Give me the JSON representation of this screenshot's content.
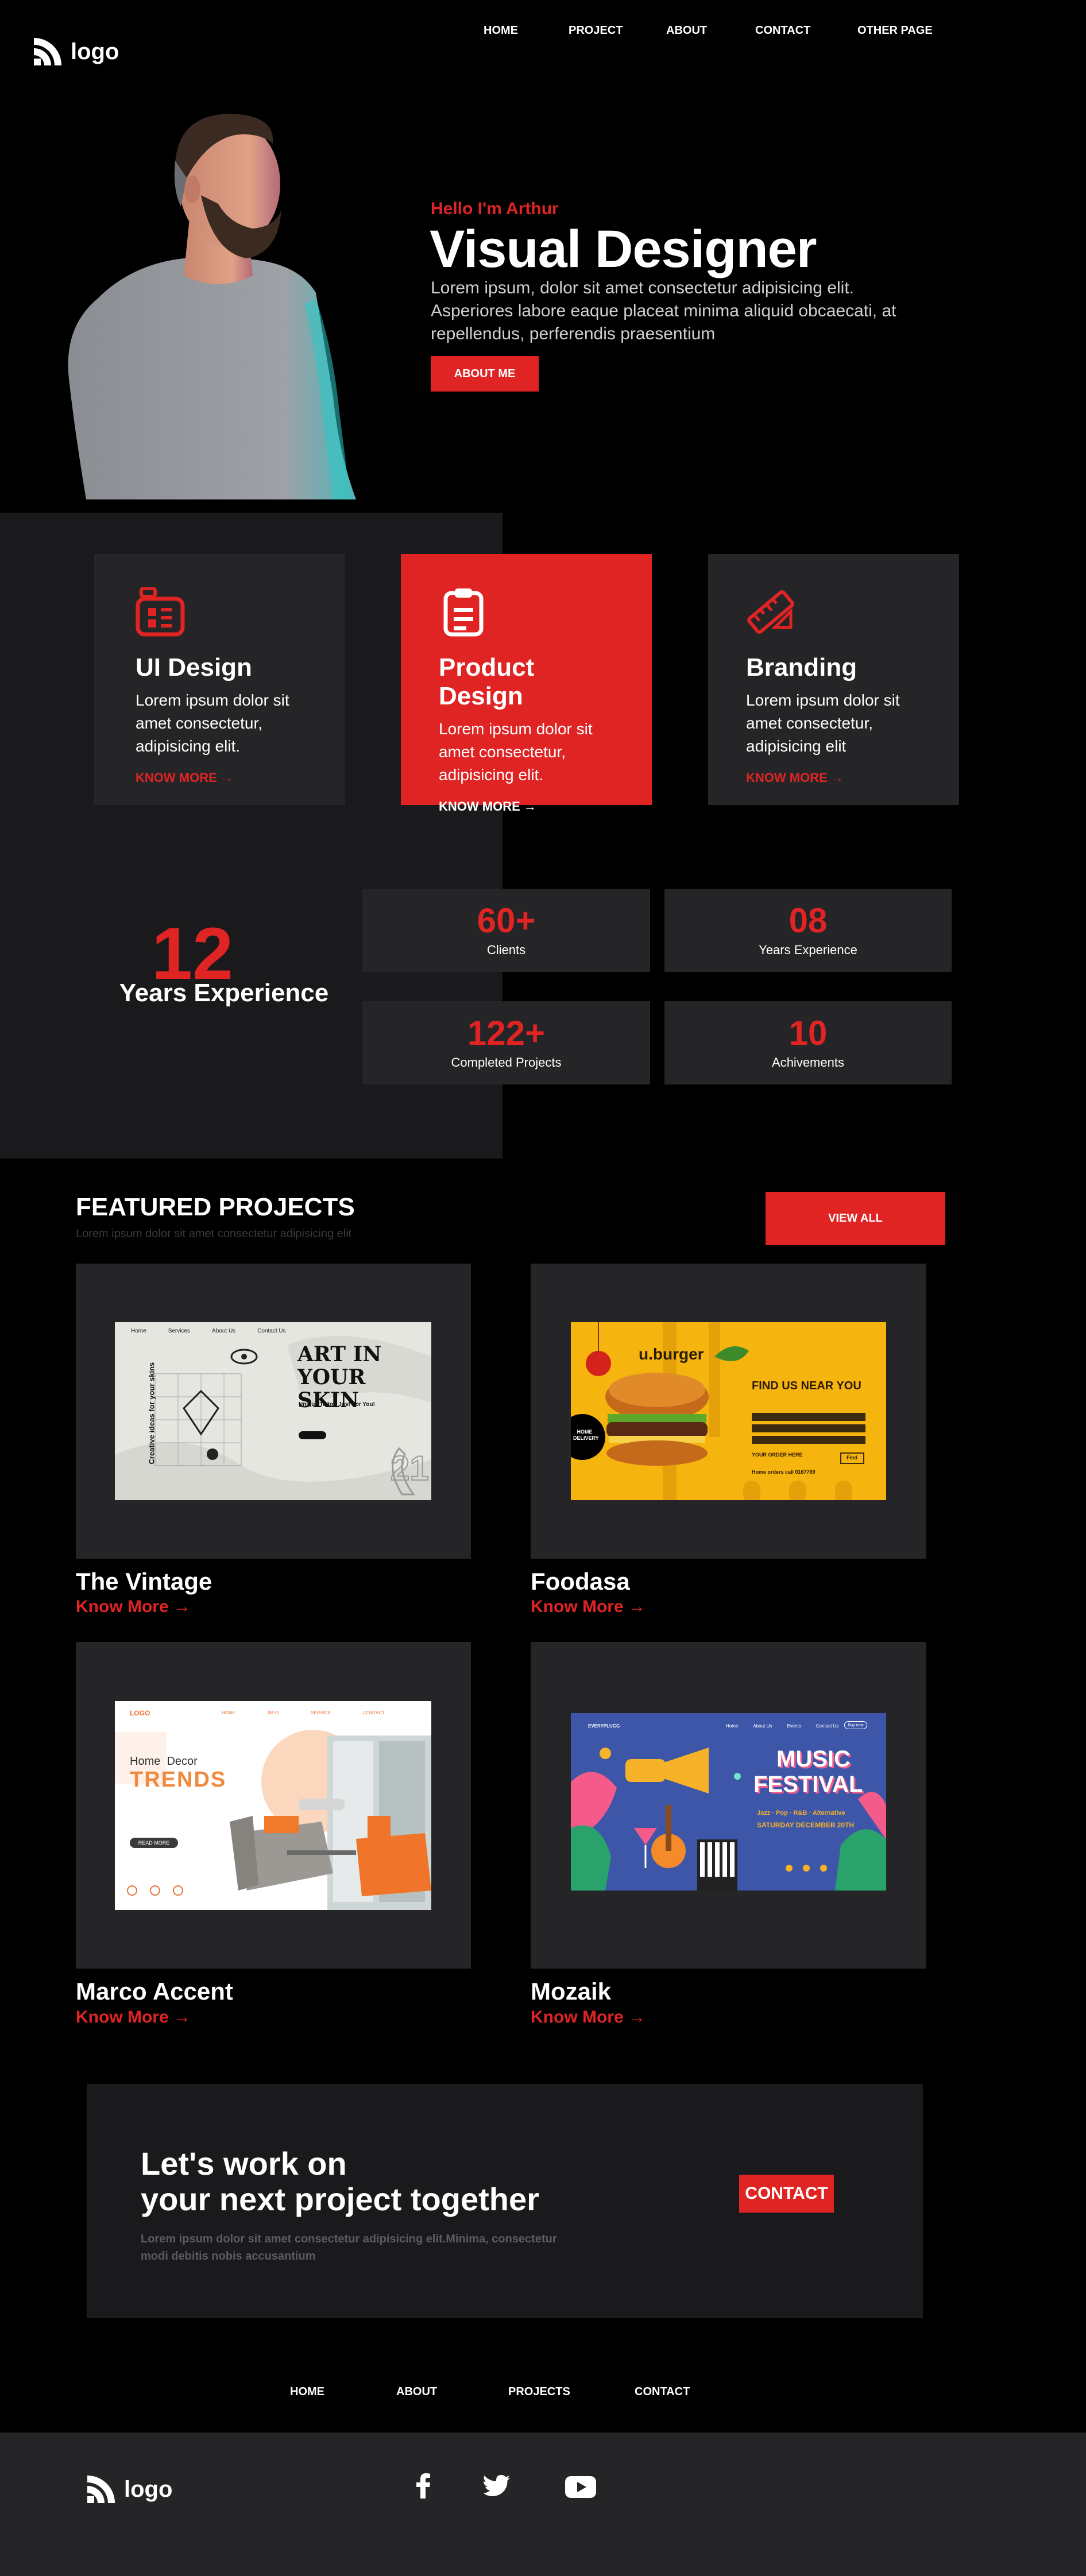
{
  "brand": {
    "logo_text": "logo"
  },
  "nav": {
    "items": [
      {
        "label": "HOME"
      },
      {
        "label": "PROJECT"
      },
      {
        "label": "ABOUT"
      },
      {
        "label": "CONTACT"
      },
      {
        "label": "OTHER PAGE"
      }
    ]
  },
  "hero": {
    "greeting": "Hello I'm Arthur",
    "title": "Visual Designer",
    "description": "Lorem ipsum, dolor sit amet consectetur adipisicing elit. Asperiores labore eaque placeat minima aliquid obcaecati, at repellendus, perferendis praesentium",
    "button": "ABOUT ME"
  },
  "services": [
    {
      "title": "UI Design",
      "description": "Lorem ipsum dolor sit amet consectetur, adipisicing elit.",
      "link": "KNOW MORE →",
      "icon": "keypad-icon"
    },
    {
      "title": "Product Design",
      "description": "Lorem ipsum dolor sit amet consectetur, adipisicing elit.",
      "link": "KNOW MORE →",
      "icon": "clipboard-icon"
    },
    {
      "title": "Branding",
      "description": "Lorem ipsum dolor sit amet consectetur, adipisicing elit",
      "link": "KNOW MORE →",
      "icon": "ruler-icon"
    }
  ],
  "experience": {
    "number": "12",
    "label": "Years Experience",
    "stats": [
      {
        "value": "60+",
        "label": "Clients"
      },
      {
        "value": "08",
        "label": "Years Experience"
      },
      {
        "value": "122+",
        "label": "Completed Projects"
      },
      {
        "value": "10",
        "label": "Achivements"
      }
    ]
  },
  "projects": {
    "title": "FEATURED PROJECTS",
    "subtitle": "Lorem ipsum dolor sit amet consectetur adipisicing elit",
    "view_all": "VIEW ALL",
    "items": [
      {
        "title": "The Vintage",
        "link": "Know More →",
        "thumb": {
          "heading1": "ART IN",
          "heading2": "YOUR SKIN",
          "side": "Creative ideas for your skins",
          "sub": "Unique Tattoo Just For You!",
          "nav": [
            "Home",
            "Services",
            "About Us",
            "Contact Us"
          ],
          "num": "21"
        }
      },
      {
        "title": "Foodasa",
        "link": "Know More →",
        "thumb": {
          "brand": "u.burger",
          "headline": "FIND US NEAR YOU",
          "badge1": "HOME",
          "badge2": "DELIVERY",
          "order": "YOUR ORDER HERE",
          "cta": "Find",
          "note": "Home orders call 0167789"
        }
      },
      {
        "title": "Marco Accent",
        "link": "Know More →",
        "thumb": {
          "logo": "LOGO",
          "line1": "Home  Decor",
          "line2": "TRENDS",
          "btn": "READ MORE",
          "nav": [
            "HOME",
            "INFO",
            "SERVICE",
            "CONTACT"
          ]
        }
      },
      {
        "title": "Mozaik",
        "link": "Know More →",
        "thumb": {
          "brand": "EVERYPLUGG",
          "title1": "MUSIC",
          "title2": "FESTIVAL",
          "tags": "Jazz · Pop · R&B · Alternative",
          "date": "SATURDAY DECEMBER 20TH",
          "nav": [
            "Home",
            "About Us",
            "Events",
            "Contact Us"
          ],
          "btn": "Buy now"
        }
      }
    ]
  },
  "cta": {
    "line1": "Let's work on",
    "line2": "your next project together",
    "description": "Lorem ipsum dolor sit amet consectetur adipisicing elit.Minima, consectetur modi debitis nobis accusantium",
    "button": "CONTACT"
  },
  "footer_nav": {
    "items": [
      {
        "label": "HOME"
      },
      {
        "label": "ABOUT"
      },
      {
        "label": "PROJECTS"
      },
      {
        "label": "CONTACT"
      }
    ]
  },
  "footer": {
    "logo_text": "logo",
    "socials": [
      {
        "icon": "facebook-icon"
      },
      {
        "icon": "twitter-icon"
      },
      {
        "icon": "youtube-icon"
      }
    ]
  },
  "colors": {
    "accent": "#E02424",
    "background": "#000000",
    "panel": "#1A1A1C",
    "card": "#252527"
  }
}
